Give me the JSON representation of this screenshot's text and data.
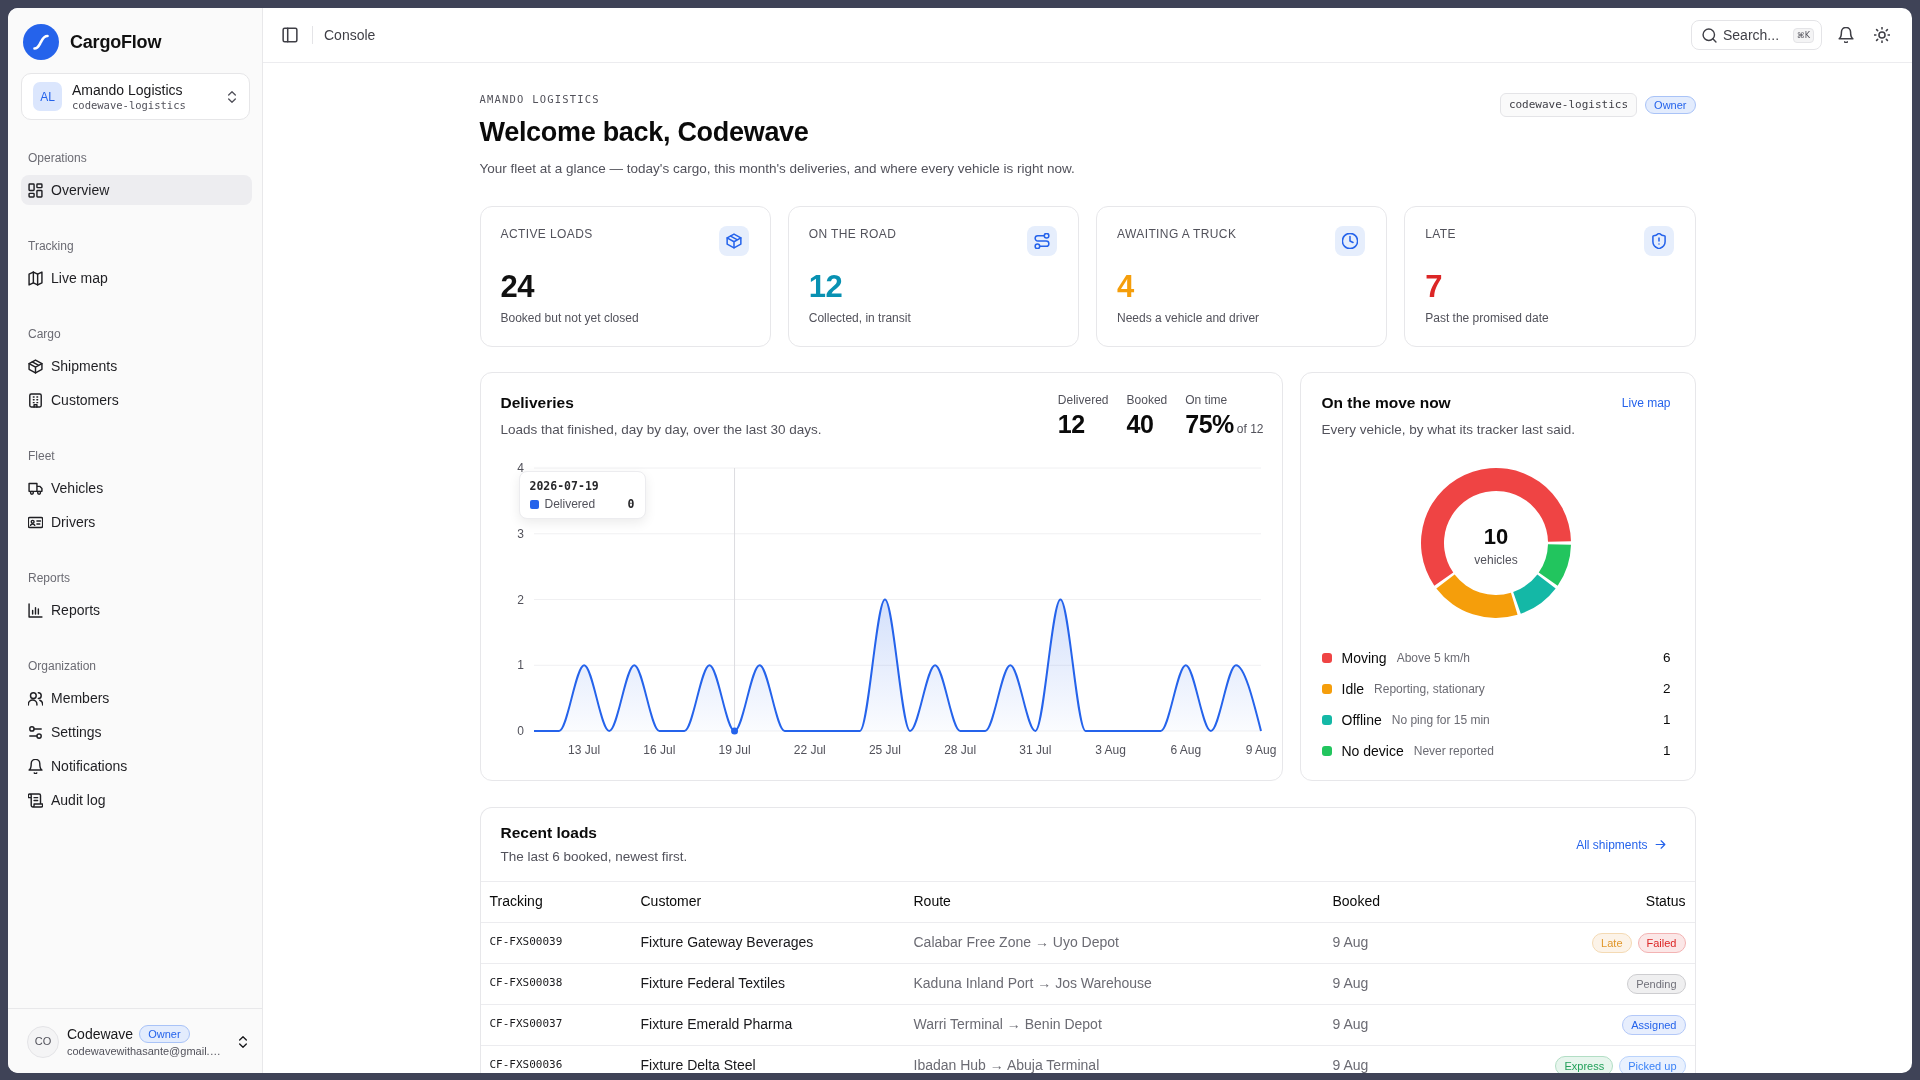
{
  "sidebar": {
    "brand": "CargoFlow",
    "org": {
      "initials": "AL",
      "name": "Amando Logistics",
      "slug": "codewave-logistics"
    },
    "sections": [
      {
        "title": "Operations",
        "items": [
          {
            "label": "Overview",
            "selected": true
          }
        ]
      },
      {
        "title": "Tracking",
        "items": [
          {
            "label": "Live map",
            "selected": false
          }
        ]
      },
      {
        "title": "Cargo",
        "items": [
          {
            "label": "Shipments",
            "selected": false
          },
          {
            "label": "Customers",
            "selected": false
          }
        ]
      },
      {
        "title": "Fleet",
        "items": [
          {
            "label": "Vehicles",
            "selected": false
          },
          {
            "label": "Drivers",
            "selected": false
          }
        ]
      },
      {
        "title": "Reports",
        "items": [
          {
            "label": "Reports",
            "selected": false
          }
        ]
      },
      {
        "title": "Organization",
        "items": [
          {
            "label": "Members",
            "selected": false
          },
          {
            "label": "Settings",
            "selected": false
          },
          {
            "label": "Notifications",
            "selected": false
          },
          {
            "label": "Audit log",
            "selected": false
          }
        ]
      }
    ],
    "user": {
      "initials": "CO",
      "name": "Codewave",
      "role": "Owner",
      "email": "codewavewithasante@gmail.…"
    }
  },
  "topbar": {
    "title": "Console",
    "search": {
      "label": "Search...",
      "shortcut": "⌘K"
    }
  },
  "header": {
    "eyebrow": "AMANDO LOGISTICS",
    "title": "Welcome back, Codewave",
    "subtitle": "Your fleet at a glance — today's cargo, this month's deliveries, and where every vehicle is right now.",
    "org_slug": "codewave-logistics",
    "role": "Owner"
  },
  "stats": [
    {
      "label": "ACTIVE LOADS",
      "value": "24",
      "caption": "Booked but not yet closed",
      "color": "#111111"
    },
    {
      "label": "ON THE ROAD",
      "value": "12",
      "caption": "Collected, in transit",
      "color": "#0891b2"
    },
    {
      "label": "AWAITING A TRUCK",
      "value": "4",
      "caption": "Needs a vehicle and driver",
      "color": "#f59e0b"
    },
    {
      "label": "LATE",
      "value": "7",
      "caption": "Past the promised date",
      "color": "#dc2626"
    }
  ],
  "deliveries": {
    "title": "Deliveries",
    "subtitle": "Loads that finished, day by day, over the last 30 days.",
    "figures": [
      {
        "label": "Delivered",
        "value": "12"
      },
      {
        "label": "Booked",
        "value": "40"
      },
      {
        "label": "On time",
        "value": "75%",
        "note": "of 12"
      }
    ],
    "chart_data": {
      "type": "area",
      "categories": [
        null,
        null,
        "13 Jul",
        null,
        null,
        "16 Jul",
        null,
        null,
        "19 Jul",
        null,
        null,
        "22 Jul",
        null,
        null,
        "25 Jul",
        null,
        null,
        "28 Jul",
        null,
        null,
        "31 Jul",
        null,
        null,
        "3 Aug",
        null,
        null,
        "6 Aug",
        null,
        null,
        "9 Aug"
      ],
      "series": [
        {
          "name": "Delivered",
          "color": "#2563eb",
          "values": [
            0,
            0,
            1,
            0,
            1,
            0,
            0,
            1,
            0,
            1,
            0,
            0,
            0,
            0,
            2,
            0,
            1,
            0,
            0,
            1,
            0,
            2,
            0,
            0,
            0,
            0,
            1,
            0,
            1,
            0
          ]
        }
      ],
      "ylim": [
        0,
        4
      ],
      "yticks": [
        0,
        1,
        2,
        3,
        4
      ],
      "grid": true,
      "annotations": [
        {
          "x": "19 Jul"
        }
      ]
    },
    "tooltip": {
      "date": "2026-07-19",
      "value": "0"
    }
  },
  "fleet": {
    "title": "On the move now",
    "link": "Live map",
    "subtitle": "Every vehicle, by what its tracker last said.",
    "total": "10",
    "total_label": "vehicles",
    "chart_data": {
      "type": "donut",
      "values": [
        60,
        20,
        10,
        10
      ]
    },
    "statuses": [
      {
        "name": "Moving",
        "note": "Above 5 km/h",
        "count": "6",
        "color": "#ef4444"
      },
      {
        "name": "Idle",
        "note": "Reporting, stationary",
        "count": "2",
        "color": "#f59e0b"
      },
      {
        "name": "Offline",
        "note": "No ping for 15 min",
        "count": "1",
        "color": "#14b8a6"
      },
      {
        "name": "No device",
        "note": "Never reported",
        "count": "1",
        "color": "#22c55e"
      }
    ]
  },
  "recent_loads": {
    "title": "Recent loads",
    "subtitle": "The last 6 booked, newest first.",
    "link": "All shipments",
    "columns": [
      "Tracking",
      "Customer",
      "Route",
      "Booked",
      "Status"
    ],
    "rows": [
      {
        "tracking": "CF-FXS00039",
        "customer": "Fixture Gateway Beverages",
        "route": "Calabar Free Zone → Uyo Depot",
        "booked": "9 Aug",
        "tags": [
          {
            "label": "Late",
            "color": "#e0962a"
          },
          {
            "label": "Failed",
            "color": "#dc2626"
          }
        ]
      },
      {
        "tracking": "CF-FXS00038",
        "customer": "Fixture Federal Textiles",
        "route": "Kaduna Inland Port → Jos Warehouse",
        "booked": "9 Aug",
        "tags": [
          {
            "label": "Pending",
            "color": "#71717a"
          }
        ]
      },
      {
        "tracking": "CF-FXS00037",
        "customer": "Fixture Emerald Pharma",
        "route": "Warri Terminal → Benin Depot",
        "booked": "9 Aug",
        "tags": [
          {
            "label": "Assigned",
            "color": "#2563eb"
          }
        ]
      },
      {
        "tracking": "CF-FXS00036",
        "customer": "Fixture Delta Steel",
        "route": "Ibadan Hub → Abuja Terminal",
        "booked": "9 Aug",
        "tags": [
          {
            "label": "Express",
            "color": "#22a05a"
          },
          {
            "label": "Picked up",
            "color": "#3b82f6"
          }
        ]
      }
    ]
  }
}
